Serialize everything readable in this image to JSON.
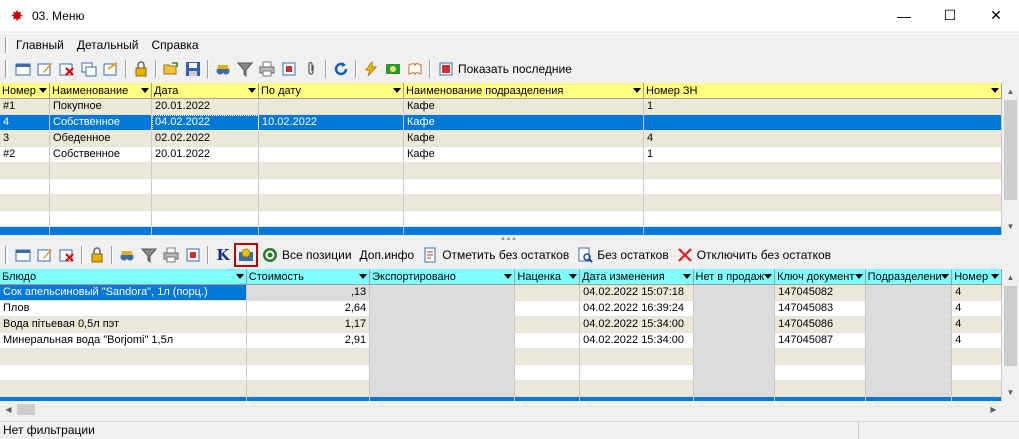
{
  "window": {
    "title": "03. Меню",
    "buttons": {
      "minimize": "—",
      "maximize": "☐",
      "close": "✕"
    }
  },
  "menu": [
    "Главный",
    "Детальный",
    "Справка"
  ],
  "top_toolbar": {
    "show_last_label": "Показать последние"
  },
  "top_grid": {
    "columns": [
      "Номер",
      "Наименование",
      "Дата",
      "По дату",
      "Наименование подразделения",
      "Номер ЗН"
    ],
    "rows": [
      [
        "#1",
        "Покупное",
        "20.01.2022",
        "",
        "Кафе",
        "1"
      ],
      [
        "4",
        "Собственное",
        "04.02.2022",
        "10.02.2022",
        "Кафе",
        ""
      ],
      [
        "3",
        "Обеденное",
        "02.02.2022",
        "",
        "Кафе",
        "4"
      ],
      [
        "#2",
        "Собственное",
        "20.01.2022",
        "",
        "Кафе",
        "1"
      ]
    ],
    "selected_row": 1
  },
  "bottom_toolbar": {
    "k_label": "K",
    "all_positions_label": "Все позиции",
    "extra_info_label": "Доп.инфо",
    "mark_no_stock_label": "Отметить без остатков",
    "no_stock_label": "Без остатков",
    "disable_no_stock_label": "Отключить без остатков"
  },
  "bottom_grid": {
    "columns": [
      "Блюдо",
      "Стоимость",
      "Экспортировано",
      "Наценка",
      "Дата изменения",
      "Нет в продаж",
      "Ключ документ",
      "Подразделени",
      "Номер"
    ],
    "rows": [
      [
        "Сок апельсиновый \"Sandora\", 1л (порц.)",
        ",13",
        "",
        "",
        "04.02.2022 15:07:18",
        "",
        "147045082",
        "",
        "4"
      ],
      [
        "Плов",
        "2,64",
        "",
        "",
        "04.02.2022 16:39:24",
        "",
        "147045083",
        "",
        "4"
      ],
      [
        "Вода пітьевая 0,5л пэт",
        "1,17",
        "",
        "",
        "04.02.2022 15:34:00",
        "",
        "147045086",
        "",
        "4"
      ],
      [
        "Минеральная вода \"Borjomi\" 1,5л",
        "2,91",
        "",
        "",
        "04.02.2022 15:34:00",
        "",
        "147045087",
        "",
        "4"
      ]
    ],
    "selected_row": 0
  },
  "status": {
    "text": "Нет фильтрации"
  },
  "colors": {
    "header_yellow": "#ffff80",
    "header_cyan": "#80ffff",
    "row_stripe": "#ebe8d8",
    "selection_blue": "#0078d7",
    "selection_text": "#ffffff",
    "grey_column": "#dcdcdc"
  }
}
